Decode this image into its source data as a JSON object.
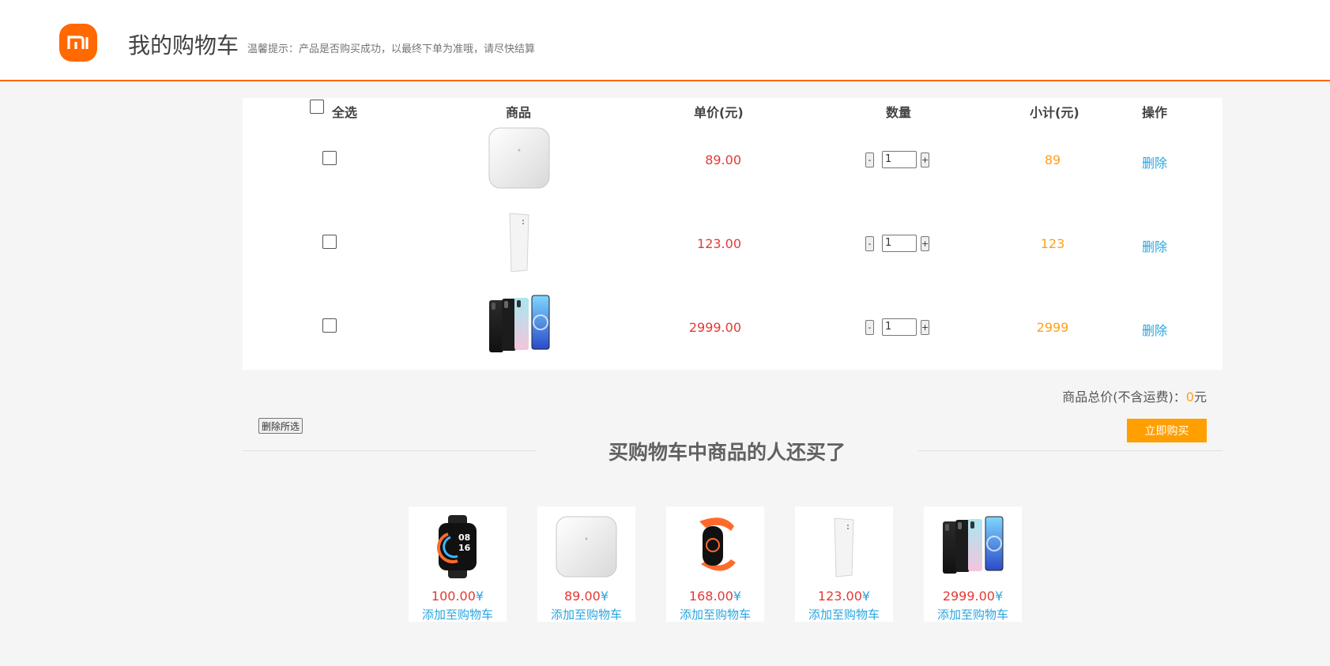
{
  "header": {
    "logo_text": "mi",
    "title": "我的购物车",
    "tip": "温馨提示：产品是否购买成功，以最终下单为准哦，请尽快结算"
  },
  "table": {
    "select_all": "全选",
    "col_product": "商品",
    "col_price": "单价(元)",
    "col_qty": "数量",
    "col_subtotal": "小计(元)",
    "col_action": "操作"
  },
  "items": [
    {
      "icon": "smart-scale-icon",
      "price": "89.00",
      "qty": "1",
      "subtotal": "89",
      "delete": "删除",
      "minus": "-",
      "plus": "+"
    },
    {
      "icon": "power-bank-icon",
      "price": "123.00",
      "qty": "1",
      "subtotal": "123",
      "delete": "删除",
      "minus": "-",
      "plus": "+"
    },
    {
      "icon": "smartphones-icon",
      "price": "2999.00",
      "qty": "1",
      "subtotal": "2999",
      "delete": "删除",
      "minus": "-",
      "plus": "+"
    }
  ],
  "summary": {
    "total_label": "商品总价(不含运费)：",
    "total_value": "0",
    "total_unit": "元",
    "delete_selected": "删除所选",
    "buy_now": "立即购买"
  },
  "recommend": {
    "title": "买购物车中商品的人还买了",
    "currency": "¥",
    "add_label": "添加至购物车",
    "items": [
      {
        "icon": "smartwatch-icon",
        "price": "100.00"
      },
      {
        "icon": "smart-scale-icon",
        "price": "89.00"
      },
      {
        "icon": "fitness-band-icon",
        "price": "168.00"
      },
      {
        "icon": "power-bank-icon",
        "price": "123.00"
      },
      {
        "icon": "smartphones-icon",
        "price": "2999.00"
      }
    ]
  },
  "colors": {
    "brand": "#ff6900",
    "price": "#e53935",
    "subtotal": "#ff9f1c",
    "link": "#29a5e0",
    "buy_button": "#ff9f00"
  }
}
